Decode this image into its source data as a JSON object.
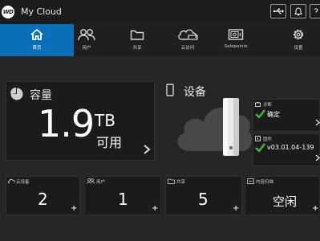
{
  "app": {
    "logo_text": "WD",
    "title": "My Cloud"
  },
  "toolbar": {
    "usb_icon": "usb-icon",
    "bell_icon": "bell-icon",
    "help_icon": "help-icon"
  },
  "nav": [
    {
      "label": "首页",
      "icon": "home-icon"
    },
    {
      "label": "用户",
      "icon": "users-icon"
    },
    {
      "label": "共享",
      "icon": "folder-icon"
    },
    {
      "label": "云访问",
      "icon": "cloud-icon"
    },
    {
      "label": "Safepoints",
      "icon": "safe-icon"
    },
    {
      "label": "设置",
      "icon": "gear-icon"
    }
  ],
  "capacity": {
    "title": "容量",
    "value": "1.9",
    "unit": "TB",
    "status": "可用"
  },
  "device": {
    "title": "设备"
  },
  "side_cards": [
    {
      "label": "诊断",
      "value": "确定"
    },
    {
      "label": "固件",
      "value": "v03.01.04-139"
    }
  ],
  "bottom_cards": [
    {
      "label": "云设备",
      "value": "2"
    },
    {
      "label": "用户",
      "value": "1"
    },
    {
      "label": "共享",
      "value": "5"
    },
    {
      "label": "内容扫描",
      "value": "空闲"
    }
  ],
  "colors": {
    "accent": "#0a6fb9",
    "ok": "#3dbb3d",
    "background": "#262626",
    "panel": "#1b1b1b"
  }
}
